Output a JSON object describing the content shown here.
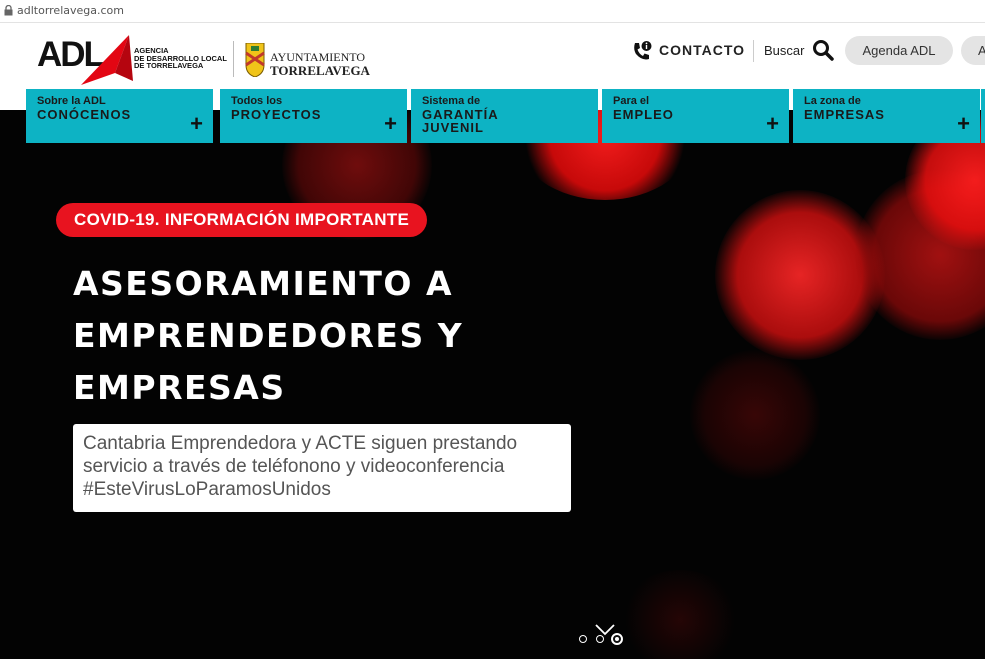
{
  "browser": {
    "url": "adltorrelavega.com"
  },
  "header": {
    "logo_text": "ADL",
    "logo_subtitle": [
      "AGENCIA",
      "DE DESARROLLO LOCAL",
      "DE TORRELAVEGA"
    ],
    "ayto_line1": "AYUNTAMIENTO",
    "ayto_line2": "TORRELAVEGA",
    "contact_label": "CONTACTO",
    "search_label": "Buscar",
    "agenda_label": "Agenda ADL",
    "cut_button_label": "A"
  },
  "nav": [
    {
      "small": "Sobre la ADL",
      "big": "CONÓCENOS",
      "expand": "+"
    },
    {
      "small": "Todos los",
      "big": "PROYECTOS",
      "expand": "+"
    },
    {
      "small": "Sistema de",
      "big": "GARANTÍA\nJUVENIL",
      "expand": ""
    },
    {
      "small": "Para el",
      "big": "EMPLEO",
      "expand": "+"
    },
    {
      "small": "La zona de",
      "big": "EMPRESAS",
      "expand": "+"
    }
  ],
  "hero": {
    "badge": "COVID-19. INFORMACIÓN IMPORTANTE",
    "headline": [
      "ASESORAMIENTO A",
      "EMPRENDEDORES Y",
      "EMPRESAS"
    ],
    "description": [
      "Cantabria Emprendedora y ACTE siguen prestando",
      "servicio a través de teléfonono y videoconferencia",
      "#EsteVirusLoParamosUnidos"
    ],
    "slides_total": 3,
    "active_slide": 3
  },
  "colors": {
    "nav_teal": "#0db3c4",
    "badge_red": "#e8131f",
    "hero_background": "#030303",
    "logo_red": "#e30613"
  }
}
